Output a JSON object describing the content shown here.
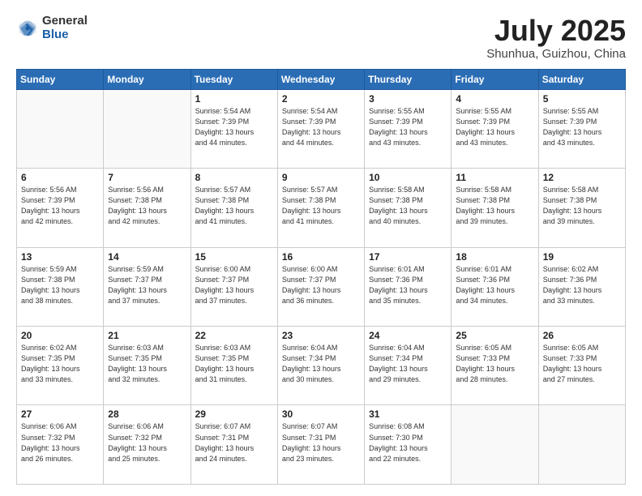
{
  "header": {
    "logo_general": "General",
    "logo_blue": "Blue",
    "month_year": "July 2025",
    "location": "Shunhua, Guizhou, China"
  },
  "weekdays": [
    "Sunday",
    "Monday",
    "Tuesday",
    "Wednesday",
    "Thursday",
    "Friday",
    "Saturday"
  ],
  "weeks": [
    [
      {
        "day": "",
        "info": ""
      },
      {
        "day": "",
        "info": ""
      },
      {
        "day": "1",
        "info": "Sunrise: 5:54 AM\nSunset: 7:39 PM\nDaylight: 13 hours\nand 44 minutes."
      },
      {
        "day": "2",
        "info": "Sunrise: 5:54 AM\nSunset: 7:39 PM\nDaylight: 13 hours\nand 44 minutes."
      },
      {
        "day": "3",
        "info": "Sunrise: 5:55 AM\nSunset: 7:39 PM\nDaylight: 13 hours\nand 43 minutes."
      },
      {
        "day": "4",
        "info": "Sunrise: 5:55 AM\nSunset: 7:39 PM\nDaylight: 13 hours\nand 43 minutes."
      },
      {
        "day": "5",
        "info": "Sunrise: 5:55 AM\nSunset: 7:39 PM\nDaylight: 13 hours\nand 43 minutes."
      }
    ],
    [
      {
        "day": "6",
        "info": "Sunrise: 5:56 AM\nSunset: 7:39 PM\nDaylight: 13 hours\nand 42 minutes."
      },
      {
        "day": "7",
        "info": "Sunrise: 5:56 AM\nSunset: 7:38 PM\nDaylight: 13 hours\nand 42 minutes."
      },
      {
        "day": "8",
        "info": "Sunrise: 5:57 AM\nSunset: 7:38 PM\nDaylight: 13 hours\nand 41 minutes."
      },
      {
        "day": "9",
        "info": "Sunrise: 5:57 AM\nSunset: 7:38 PM\nDaylight: 13 hours\nand 41 minutes."
      },
      {
        "day": "10",
        "info": "Sunrise: 5:58 AM\nSunset: 7:38 PM\nDaylight: 13 hours\nand 40 minutes."
      },
      {
        "day": "11",
        "info": "Sunrise: 5:58 AM\nSunset: 7:38 PM\nDaylight: 13 hours\nand 39 minutes."
      },
      {
        "day": "12",
        "info": "Sunrise: 5:58 AM\nSunset: 7:38 PM\nDaylight: 13 hours\nand 39 minutes."
      }
    ],
    [
      {
        "day": "13",
        "info": "Sunrise: 5:59 AM\nSunset: 7:38 PM\nDaylight: 13 hours\nand 38 minutes."
      },
      {
        "day": "14",
        "info": "Sunrise: 5:59 AM\nSunset: 7:37 PM\nDaylight: 13 hours\nand 37 minutes."
      },
      {
        "day": "15",
        "info": "Sunrise: 6:00 AM\nSunset: 7:37 PM\nDaylight: 13 hours\nand 37 minutes."
      },
      {
        "day": "16",
        "info": "Sunrise: 6:00 AM\nSunset: 7:37 PM\nDaylight: 13 hours\nand 36 minutes."
      },
      {
        "day": "17",
        "info": "Sunrise: 6:01 AM\nSunset: 7:36 PM\nDaylight: 13 hours\nand 35 minutes."
      },
      {
        "day": "18",
        "info": "Sunrise: 6:01 AM\nSunset: 7:36 PM\nDaylight: 13 hours\nand 34 minutes."
      },
      {
        "day": "19",
        "info": "Sunrise: 6:02 AM\nSunset: 7:36 PM\nDaylight: 13 hours\nand 33 minutes."
      }
    ],
    [
      {
        "day": "20",
        "info": "Sunrise: 6:02 AM\nSunset: 7:35 PM\nDaylight: 13 hours\nand 33 minutes."
      },
      {
        "day": "21",
        "info": "Sunrise: 6:03 AM\nSunset: 7:35 PM\nDaylight: 13 hours\nand 32 minutes."
      },
      {
        "day": "22",
        "info": "Sunrise: 6:03 AM\nSunset: 7:35 PM\nDaylight: 13 hours\nand 31 minutes."
      },
      {
        "day": "23",
        "info": "Sunrise: 6:04 AM\nSunset: 7:34 PM\nDaylight: 13 hours\nand 30 minutes."
      },
      {
        "day": "24",
        "info": "Sunrise: 6:04 AM\nSunset: 7:34 PM\nDaylight: 13 hours\nand 29 minutes."
      },
      {
        "day": "25",
        "info": "Sunrise: 6:05 AM\nSunset: 7:33 PM\nDaylight: 13 hours\nand 28 minutes."
      },
      {
        "day": "26",
        "info": "Sunrise: 6:05 AM\nSunset: 7:33 PM\nDaylight: 13 hours\nand 27 minutes."
      }
    ],
    [
      {
        "day": "27",
        "info": "Sunrise: 6:06 AM\nSunset: 7:32 PM\nDaylight: 13 hours\nand 26 minutes."
      },
      {
        "day": "28",
        "info": "Sunrise: 6:06 AM\nSunset: 7:32 PM\nDaylight: 13 hours\nand 25 minutes."
      },
      {
        "day": "29",
        "info": "Sunrise: 6:07 AM\nSunset: 7:31 PM\nDaylight: 13 hours\nand 24 minutes."
      },
      {
        "day": "30",
        "info": "Sunrise: 6:07 AM\nSunset: 7:31 PM\nDaylight: 13 hours\nand 23 minutes."
      },
      {
        "day": "31",
        "info": "Sunrise: 6:08 AM\nSunset: 7:30 PM\nDaylight: 13 hours\nand 22 minutes."
      },
      {
        "day": "",
        "info": ""
      },
      {
        "day": "",
        "info": ""
      }
    ]
  ]
}
